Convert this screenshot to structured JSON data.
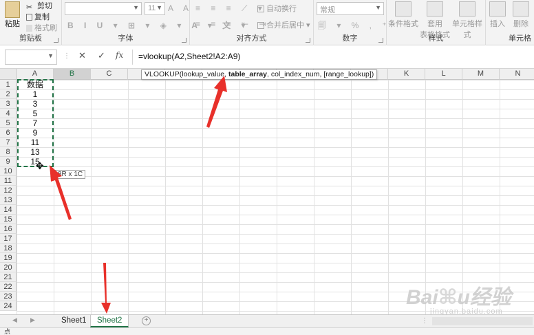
{
  "ribbon": {
    "clipboard": {
      "paste": "粘贴",
      "cut": "剪切",
      "copy": "复制",
      "format_painter": "格式刷",
      "label": "剪贴板"
    },
    "font": {
      "size": "11",
      "label": "字体"
    },
    "alignment": {
      "wrap_text": "自动换行",
      "merge_center": "合并后居中",
      "label": "对齐方式"
    },
    "number": {
      "format": "常规",
      "label": "数字"
    },
    "styles": {
      "conditional": "条件格式",
      "table_format_line1": "套用",
      "table_format_line2": "表格格式",
      "cell_styles": "单元格样式",
      "label": "样式"
    },
    "cells": {
      "insert": "插入",
      "delete": "删除",
      "label": "单元格"
    }
  },
  "formula_bar": {
    "formula": "=vlookup(A2,Sheet2!A2:A9)",
    "cancel": "✕",
    "enter": "✓",
    "fx": "fx"
  },
  "grid": {
    "columns": [
      "A",
      "B",
      "C",
      "D",
      "E",
      "F",
      "G",
      "H",
      "I",
      "J",
      "K",
      "L",
      "M",
      "N"
    ],
    "selected_column": "B",
    "rows": [
      "1",
      "2",
      "3",
      "4",
      "5",
      "6",
      "7",
      "8",
      "9",
      "10",
      "11",
      "12",
      "13",
      "14",
      "15",
      "16",
      "17",
      "18",
      "19",
      "20",
      "21",
      "22",
      "23",
      "24"
    ],
    "column_a_values": [
      "数据",
      "1",
      "3",
      "5",
      "7",
      "9",
      "11",
      "13",
      "15"
    ]
  },
  "tooltip": {
    "prefix": "VLOOKUP(lookup_value, ",
    "bold": "table_array",
    "suffix": ", col_index_num, [range_lookup])"
  },
  "size_tip": "8R x 1C",
  "sheets": {
    "tabs": [
      "Sheet1",
      "Sheet2"
    ],
    "active": "Sheet2"
  },
  "status": {
    "mode": "点"
  },
  "watermark": {
    "logo": "Baidu经验",
    "url": "jingyan.baidu.com"
  },
  "colors": {
    "accent": "#217346",
    "arrow": "#e8302a"
  }
}
